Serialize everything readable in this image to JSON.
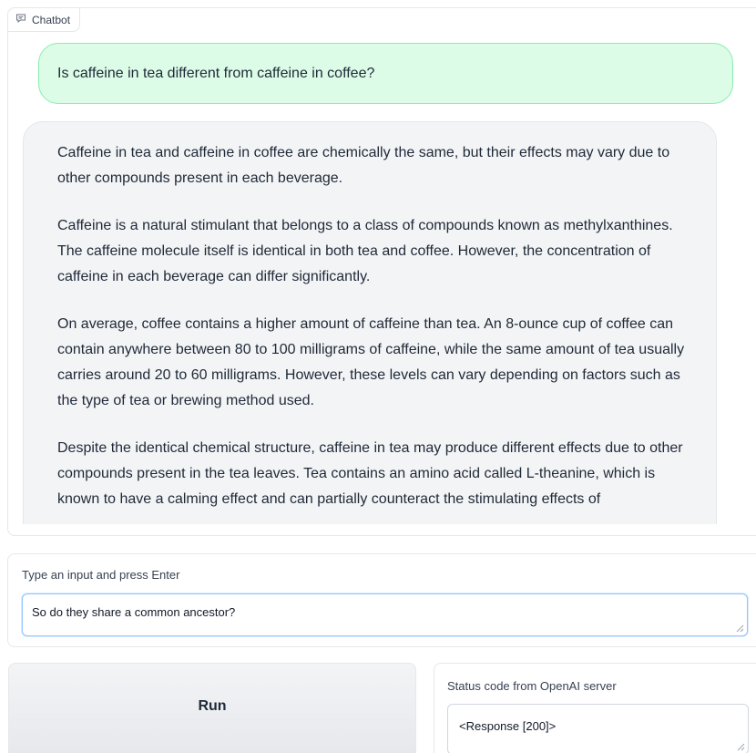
{
  "chatbot": {
    "label": "Chatbot",
    "user_message": "Is caffeine in tea different from caffeine in coffee?",
    "bot_paragraphs": [
      "Caffeine in tea and caffeine in coffee are chemically the same, but their effects may vary due to other compounds present in each beverage.",
      "Caffeine is a natural stimulant that belongs to a class of compounds known as methylxanthines. The caffeine molecule itself is identical in both tea and coffee. However, the concentration of caffeine in each beverage can differ significantly.",
      "On average, coffee contains a higher amount of caffeine than tea. An 8-ounce cup of coffee can contain anywhere between 80 to 100 milligrams of caffeine, while the same amount of tea usually carries around 20 to 60 milligrams. However, these levels can vary depending on factors such as the type of tea or brewing method used.",
      "Despite the identical chemical structure, caffeine in tea may produce different effects due to other compounds present in the tea leaves. Tea contains an amino acid called L-theanine, which is known to have a calming effect and can partially counteract the stimulating effects of"
    ]
  },
  "input": {
    "label": "Type an input and press Enter",
    "value": "So do they share a common ancestor?"
  },
  "run_button": {
    "label": "Run"
  },
  "status": {
    "label": "Status code from OpenAI server",
    "value": "<Response [200]>"
  },
  "icons": {
    "chatbot": "chat-bubble-icon",
    "resize": "resize-grip-icon"
  },
  "colors": {
    "user_bubble": "#dcfce7",
    "user_border": "#86efac",
    "bot_bubble": "#f3f4f6",
    "focus_border": "#93c5fd"
  }
}
